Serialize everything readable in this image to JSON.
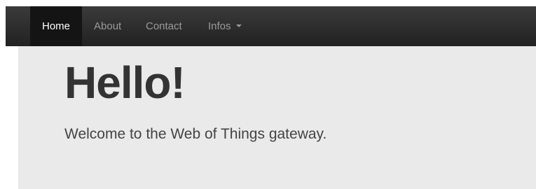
{
  "navbar": {
    "items": [
      {
        "label": "Home",
        "active": true
      },
      {
        "label": "About",
        "active": false
      },
      {
        "label": "Contact",
        "active": false
      },
      {
        "label": "Infos",
        "active": false,
        "has_dropdown": true,
        "icon": "caret-down-icon"
      }
    ]
  },
  "jumbotron": {
    "title": "Hello!",
    "lead": "Welcome to the Web of Things gateway."
  },
  "colors": {
    "navbar_bg": "#2b2b2b",
    "active_bg": "#141414",
    "nav_text": "#9a9a9a",
    "jumbotron_bg": "#eaeaea",
    "title_text": "#333333"
  }
}
